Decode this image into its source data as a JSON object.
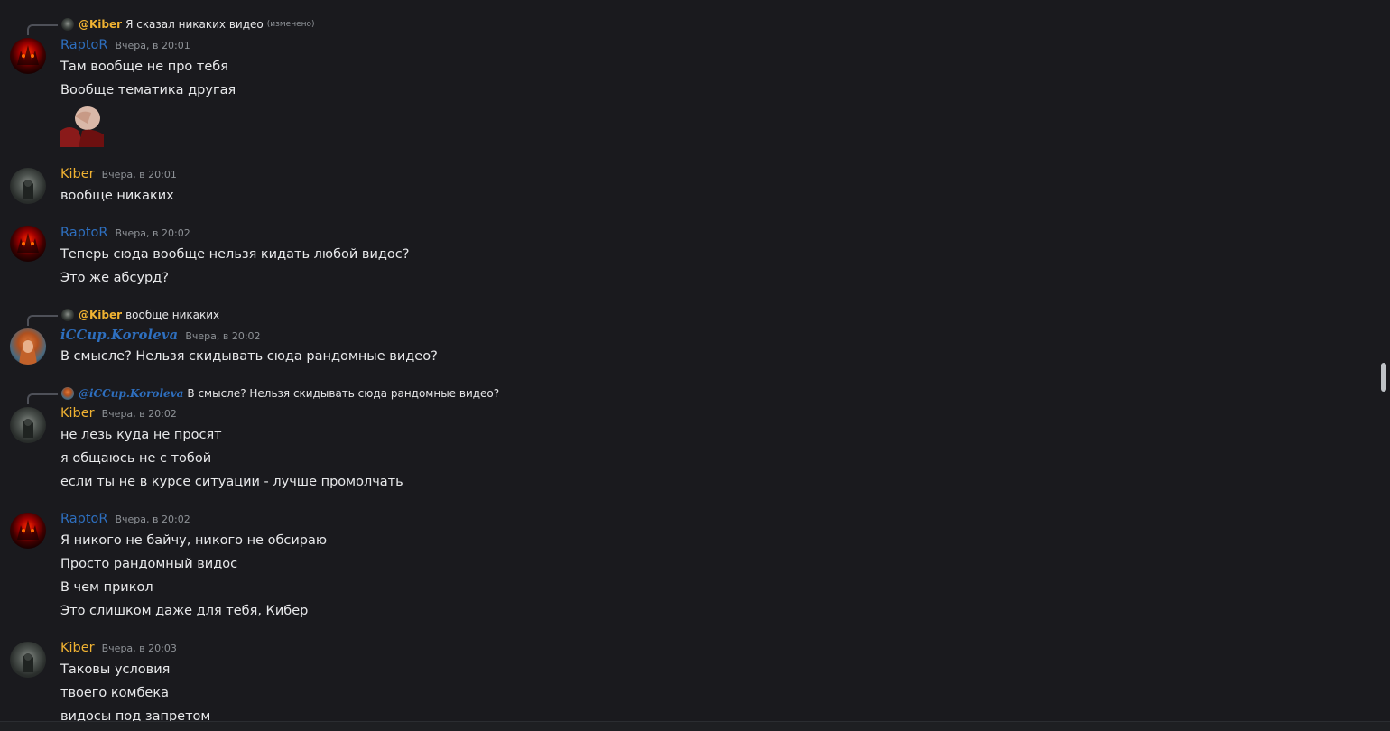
{
  "messages": [
    {
      "reply": {
        "name": "@Kiber",
        "text": "Я сказал никаких видео",
        "edited": "(изменено)"
      },
      "author": "RaptoR",
      "time": "Вчера, в 20:01",
      "lines": [
        "Там вообще не про тебя",
        "Вообще тематика другая"
      ],
      "sticker": "facepalm-sticker"
    },
    {
      "author": "Kiber",
      "time": "Вчера, в 20:01",
      "lines": [
        "вообще никаких"
      ]
    },
    {
      "author": "RaptoR",
      "time": "Вчера, в 20:02",
      "lines": [
        "Теперь сюда вообще нельзя кидать любой видос?",
        "Это же абсурд?"
      ]
    },
    {
      "reply": {
        "name": "@Kiber",
        "text": "вообще никаких"
      },
      "author": "iCCup.Koroleva",
      "time": "Вчера, в 20:02",
      "lines": [
        "В смысле? Нельзя скидывать сюда рандомные видео?"
      ]
    },
    {
      "reply": {
        "name": "@iCCup.Koroleva",
        "text": "В смысле? Нельзя скидывать сюда рандомные видео?"
      },
      "author": "Kiber",
      "time": "Вчера, в 20:02",
      "lines": [
        "не лезь куда не просят",
        "я общаюсь не с тобой",
        "если ты не в курсе ситуации - лучше промолчать"
      ]
    },
    {
      "author": "RaptoR",
      "time": "Вчера, в 20:02",
      "lines": [
        "Я никого не байчу, никого не обсираю",
        "Просто рандомный видос",
        "В чем прикол",
        "Это слишком даже для тебя, Кибер"
      ]
    },
    {
      "author": "Kiber",
      "time": "Вчера, в 20:03",
      "lines": [
        "Таковы условия",
        "твоего комбека",
        "видосы под запретом"
      ]
    }
  ],
  "colors": {
    "background": "#1a1a1e",
    "raptor_name": "#2e6fbf",
    "kiber_name": "#f0b232",
    "koroleva_name": "#2e6fbf",
    "timestamp": "#8e9297",
    "message_text": "#e8e9eb"
  }
}
